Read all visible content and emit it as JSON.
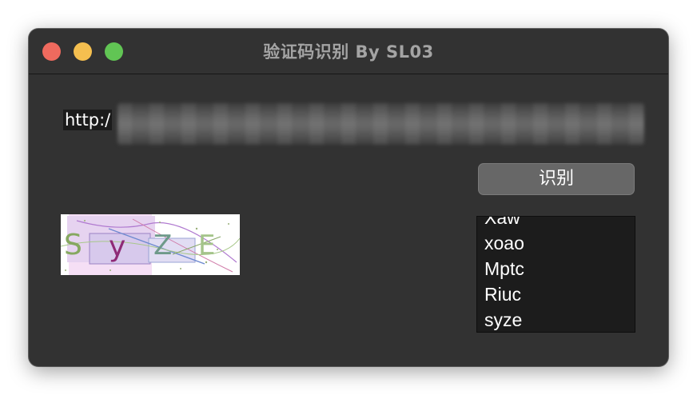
{
  "window": {
    "title": "验证码识别 By SL03"
  },
  "url_field": {
    "value": "http:/"
  },
  "recognize_button": {
    "label": "识别"
  },
  "captcha_image": {
    "text": "syzE"
  },
  "results": {
    "items": [
      "Xaw",
      "xoao",
      "Mptc",
      "Riuc",
      "syze"
    ]
  },
  "colors": {
    "window_bg": "#323232",
    "close": "#ef6a5e",
    "minimize": "#f5bf4f",
    "maximize": "#61c554",
    "button_bg": "#676767",
    "list_bg": "#1c1c1c"
  }
}
